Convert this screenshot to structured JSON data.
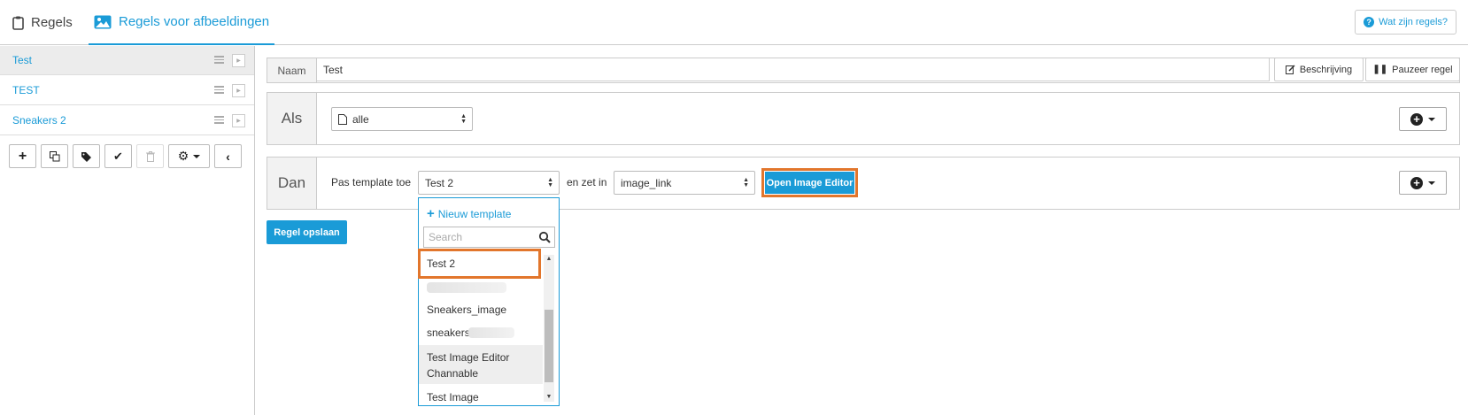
{
  "tabs": [
    {
      "label": "Regels",
      "icon": "clipboard-icon"
    },
    {
      "label": "Regels voor afbeeldingen",
      "icon": "image-icon"
    }
  ],
  "help": {
    "label": "Wat zijn regels?"
  },
  "sidebar": {
    "rules": [
      {
        "label": "Test",
        "active": true
      },
      {
        "label": "TEST",
        "active": false
      },
      {
        "label": "Sneakers 2",
        "active": false
      }
    ],
    "toolbar": [
      "plus-icon",
      "copy-icon",
      "tags-icon",
      "check-icon",
      "trash-icon",
      "gear-icon",
      "chevron-left-icon"
    ]
  },
  "name_row": {
    "label": "Naam",
    "value": "Test",
    "description_button": "Beschrijving",
    "pause_button": "Pauzeer regel"
  },
  "if_row": {
    "label": "Als",
    "select_value": "alle"
  },
  "then_row": {
    "label": "Dan",
    "apply_template_label": "Pas template toe",
    "template_value": "Test 2",
    "set_in_label": "en zet in",
    "field_value": "image_link",
    "open_editor_button": "Open Image Editor"
  },
  "save_button": "Regel opslaan",
  "dropdown": {
    "new_template": "Nieuw template",
    "search_placeholder": "Search",
    "options": [
      "Test 2",
      "Sneakers_image",
      "sneakers",
      "Test Image Editor Channable",
      "Test Image"
    ]
  },
  "colors": {
    "accent": "#1a9bd7",
    "highlight": "#e2762c"
  }
}
